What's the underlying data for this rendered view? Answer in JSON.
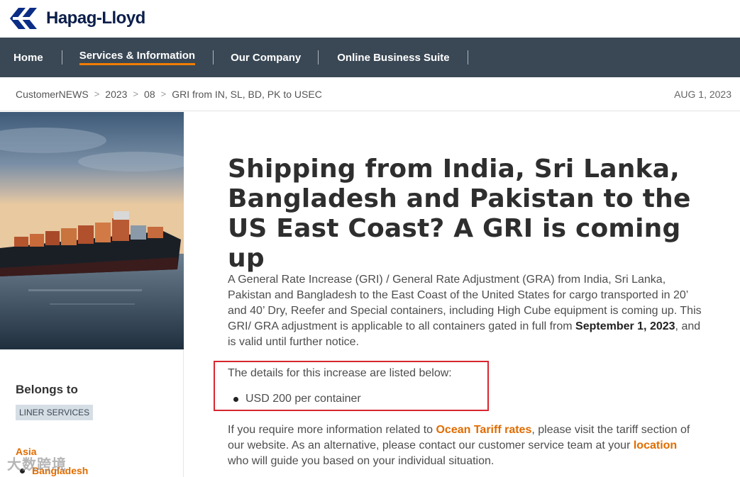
{
  "brand": {
    "name": "Hapag-Lloyd",
    "logo_icon": "hapag-lloyd-logo-icon"
  },
  "nav": {
    "items": [
      {
        "label": "Home",
        "active": false
      },
      {
        "label": "Services & Information",
        "active": true
      },
      {
        "label": "Our Company",
        "active": false
      },
      {
        "label": "Online Business Suite",
        "active": false
      }
    ],
    "active_underline_color": "#f07d00"
  },
  "breadcrumb": {
    "items": [
      "CustomerNEWS",
      "2023",
      "08"
    ],
    "current": "GRI from IN, SL, BD, PK to USEC",
    "separator": ">"
  },
  "date": "AUG 1, 2023",
  "article": {
    "title": "Shipping from India, Sri Lanka, Bangladesh and Pakistan to the US East Coast? A GRI is coming up",
    "paragraph1_pre": "A General Rate Increase (GRI) / General Rate Adjustment (GRA) from India, Sri Lanka, Pakistan and Bangladesh to the East Coast of the United States for cargo transported in 20’ and 40’ Dry, Reefer and Special containers, including High Cube equipment is coming up. This GRI/ GRA adjustment is applicable to all containers gated in full from ",
    "paragraph1_bold": "September 1, 2023",
    "paragraph1_post": ", and is valid until further notice.",
    "details_intro": "The details for this increase are listed below:",
    "details_item": "USD 200 per container",
    "paragraph2_pre": "If you require more information related to ",
    "link_tariff": "Ocean Tariff rates",
    "paragraph2_mid": ", please visit the tariff section of our website. As an alternative, please contact our customer service team at your ",
    "link_location": "location",
    "paragraph2_post": " who will guide you based on your individual situation."
  },
  "sidebar": {
    "belongs_label": "Belongs to",
    "tag": "LINER SERVICES",
    "region": "Asia",
    "subregion": "Bangladesh"
  },
  "watermark": "大数跨境",
  "colors": {
    "nav_bg": "#3a4855",
    "accent": "#e06c00",
    "highlight_border": "#d9262e"
  }
}
